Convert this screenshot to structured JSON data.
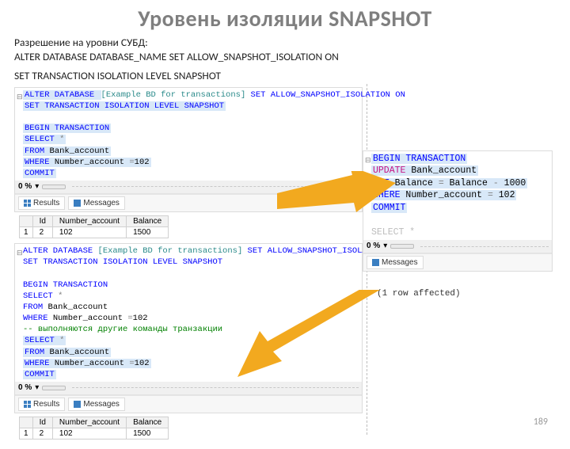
{
  "title": "Уровень изоляции SNAPSHOT",
  "intro": {
    "line1": "Разрешение на уровни СУБД:",
    "line2": "ALTER DATABASE DATABASE_NAME SET ALLOW_SNAPSHOT_ISOLATION ON",
    "line3": "SET TRANSACTION ISOLATION LEVEL SNAPSHOT"
  },
  "left1": {
    "l1a": "ALTER DATABASE ",
    "l1b": "[Example BD for transactions] ",
    "l1c": "SET ALLOW_SNAPSHOT_ISOLATION ON",
    "l2": "SET TRANSACTION ISOLATION LEVEL SNAPSHOT",
    "blank": " ",
    "begin": "BEGIN TRANSACTION",
    "select": "SELECT ",
    "star": "*",
    "from": "FROM ",
    "table": "Bank_account",
    "where": "WHERE ",
    "col": "Number_account ",
    "eq": "=",
    "val": "102",
    "commit": "COMMIT"
  },
  "status": {
    "pct": "0 %",
    "div": "▾"
  },
  "tabs": {
    "results": "Results",
    "messages": "Messages"
  },
  "res1": {
    "h0": "",
    "h1": "Id",
    "h2": "Number_account",
    "h3": "Balance",
    "r0": "1",
    "r1": "2",
    "r2": "102",
    "r3": "1500"
  },
  "left2": {
    "l1a": "ALTER DATABASE ",
    "l1b": "[Example BD for transactions] ",
    "l1c": "SET ALLOW_SNAPSHOT_ISOLATION ON",
    "l2": "SET TRANSACTION ISOLATION LEVEL SNAPSHOT",
    "blank": " ",
    "begin": "BEGIN TRANSACTION",
    "select": "SELECT ",
    "star": "*",
    "from": "FROM ",
    "table": "Bank_account",
    "where": "WHERE ",
    "col": "Number_account ",
    "eq": "=",
    "val": "102",
    "comment": "-- выполняются другие команды транзакции",
    "select2": "SELECT ",
    "star2": "*",
    "from2": "FROM ",
    "table2": "Bank_account",
    "where2": "WHERE ",
    "col2": "Number_account ",
    "eq2": "=",
    "val2": "102",
    "commit": "COMMIT"
  },
  "right": {
    "begin": "BEGIN TRANSACTION",
    "upd": "UPDATE ",
    "tbl": "Bank_account",
    "set": "SET ",
    "balcol": "Balance ",
    "eq": "= ",
    "balcol2": "Balance ",
    "minus": "- ",
    "amount": "1000",
    "where": "WHERE ",
    "col": "Number_account ",
    "eq2": "= ",
    "val": "102",
    "commit": "COMMIT",
    "blank": " ",
    "selpart": "SELECT *"
  },
  "affected": "(1 row affected)",
  "pagenum": "189"
}
